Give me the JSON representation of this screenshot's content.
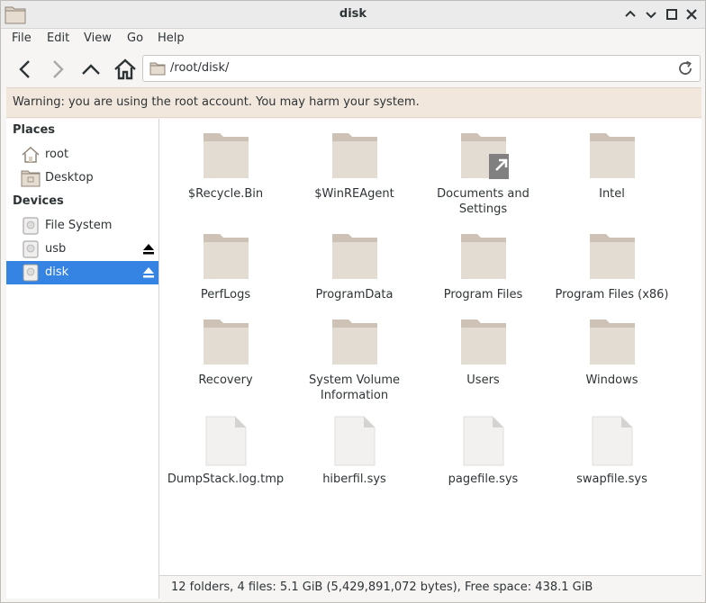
{
  "window": {
    "title": "disk"
  },
  "menu": [
    "File",
    "Edit",
    "View",
    "Go",
    "Help"
  ],
  "location": {
    "path": "/root/disk/"
  },
  "warning": "Warning: you are using the root account. You may harm your system.",
  "sidebar": {
    "places_title": "Places",
    "places": [
      {
        "label": "root",
        "icon": "home-icon"
      },
      {
        "label": "Desktop",
        "icon": "desktop-folder-icon"
      }
    ],
    "devices_title": "Devices",
    "devices": [
      {
        "label": "File System",
        "icon": "drive-icon",
        "eject": false,
        "selected": false
      },
      {
        "label": "usb",
        "icon": "drive-icon",
        "eject": true,
        "selected": false
      },
      {
        "label": "disk",
        "icon": "drive-icon",
        "eject": true,
        "selected": true
      }
    ]
  },
  "files": [
    {
      "name": "$Recycle.Bin",
      "type": "folder"
    },
    {
      "name": "$WinREAgent",
      "type": "folder"
    },
    {
      "name": "Documents and Settings",
      "type": "folder-link"
    },
    {
      "name": "Intel",
      "type": "folder"
    },
    {
      "name": "PerfLogs",
      "type": "folder"
    },
    {
      "name": "ProgramData",
      "type": "folder"
    },
    {
      "name": "Program Files",
      "type": "folder"
    },
    {
      "name": "Program Files (x86)",
      "type": "folder"
    },
    {
      "name": "Recovery",
      "type": "folder"
    },
    {
      "name": "System Volume Information",
      "type": "folder"
    },
    {
      "name": "Users",
      "type": "folder"
    },
    {
      "name": "Windows",
      "type": "folder"
    },
    {
      "name": "DumpStack.log.tmp",
      "type": "file"
    },
    {
      "name": "hiberfil.sys",
      "type": "file"
    },
    {
      "name": "pagefile.sys",
      "type": "file"
    },
    {
      "name": "swapfile.sys",
      "type": "file"
    }
  ],
  "status": "12 folders, 4 files: 5.1 GiB (5,429,891,072 bytes), Free space: 438.1 GiB"
}
